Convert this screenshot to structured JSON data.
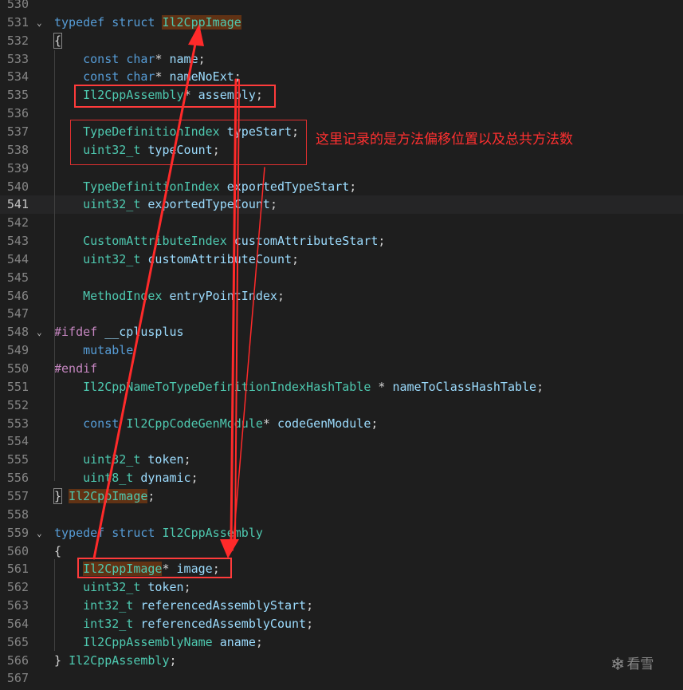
{
  "lines": [
    {
      "n": "530",
      "t": []
    },
    {
      "n": "531",
      "fold": "v",
      "t": [
        [
          "kw",
          "typedef"
        ],
        [
          "pl",
          " "
        ],
        [
          "kw",
          "struct"
        ],
        [
          "pl",
          " "
        ],
        [
          "ty hl",
          "Il2CppImage"
        ]
      ]
    },
    {
      "n": "532",
      "t": [
        [
          "pl br",
          "{"
        ]
      ]
    },
    {
      "n": "533",
      "t": [
        [
          "pl",
          "    "
        ],
        [
          "kw",
          "const"
        ],
        [
          "pl",
          " "
        ],
        [
          "kw",
          "char"
        ],
        [
          "pl",
          "* "
        ],
        [
          "id",
          "name"
        ],
        [
          "pl",
          ";"
        ]
      ]
    },
    {
      "n": "534",
      "t": [
        [
          "pl",
          "    "
        ],
        [
          "kw",
          "const"
        ],
        [
          "pl",
          " "
        ],
        [
          "kw",
          "char"
        ],
        [
          "pl",
          "* "
        ],
        [
          "id",
          "nameNoExt"
        ],
        [
          "pl",
          ";"
        ]
      ]
    },
    {
      "n": "535",
      "t": [
        [
          "pl",
          "    "
        ],
        [
          "ty",
          "Il2CppAssembly"
        ],
        [
          "pl",
          "* "
        ],
        [
          "id",
          "assembly"
        ],
        [
          "pl",
          ";"
        ]
      ]
    },
    {
      "n": "536",
      "t": []
    },
    {
      "n": "537",
      "t": [
        [
          "pl",
          "    "
        ],
        [
          "ty",
          "TypeDefinitionIndex"
        ],
        [
          "pl",
          " "
        ],
        [
          "id",
          "typeStart"
        ],
        [
          "pl",
          ";"
        ]
      ]
    },
    {
      "n": "538",
      "t": [
        [
          "pl",
          "    "
        ],
        [
          "ty",
          "uint32_t"
        ],
        [
          "pl",
          " "
        ],
        [
          "id",
          "typeCount"
        ],
        [
          "pl",
          ";"
        ]
      ]
    },
    {
      "n": "539",
      "t": []
    },
    {
      "n": "540",
      "t": [
        [
          "pl",
          "    "
        ],
        [
          "ty",
          "TypeDefinitionIndex"
        ],
        [
          "pl",
          " "
        ],
        [
          "id",
          "exportedTypeStart"
        ],
        [
          "pl",
          ";"
        ]
      ]
    },
    {
      "n": "541",
      "cur": true,
      "t": [
        [
          "pl",
          "    "
        ],
        [
          "ty",
          "uint32_t"
        ],
        [
          "pl",
          " "
        ],
        [
          "id",
          "exportedTypeCount"
        ],
        [
          "pl",
          ";"
        ]
      ]
    },
    {
      "n": "542",
      "t": []
    },
    {
      "n": "543",
      "t": [
        [
          "pl",
          "    "
        ],
        [
          "ty",
          "CustomAttributeIndex"
        ],
        [
          "pl",
          " "
        ],
        [
          "id",
          "customAttributeStart"
        ],
        [
          "pl",
          ";"
        ]
      ]
    },
    {
      "n": "544",
      "t": [
        [
          "pl",
          "    "
        ],
        [
          "ty",
          "uint32_t"
        ],
        [
          "pl",
          " "
        ],
        [
          "id",
          "customAttributeCount"
        ],
        [
          "pl",
          ";"
        ]
      ]
    },
    {
      "n": "545",
      "t": []
    },
    {
      "n": "546",
      "t": [
        [
          "pl",
          "    "
        ],
        [
          "ty",
          "MethodIndex"
        ],
        [
          "pl",
          " "
        ],
        [
          "id",
          "entryPointIndex"
        ],
        [
          "pl",
          ";"
        ]
      ]
    },
    {
      "n": "547",
      "t": []
    },
    {
      "n": "548",
      "fold": "v",
      "t": [
        [
          "pp",
          "#ifdef"
        ],
        [
          "pl",
          " "
        ],
        [
          "id",
          "__cplusplus"
        ]
      ]
    },
    {
      "n": "549",
      "t": [
        [
          "pl",
          "    "
        ],
        [
          "kw",
          "mutable"
        ]
      ]
    },
    {
      "n": "550",
      "t": [
        [
          "pp",
          "#endif"
        ]
      ]
    },
    {
      "n": "551",
      "t": [
        [
          "pl",
          "    "
        ],
        [
          "ty",
          "Il2CppNameToTypeDefinitionIndexHashTable"
        ],
        [
          "pl",
          " * "
        ],
        [
          "id",
          "nameToClassHashTable"
        ],
        [
          "pl",
          ";"
        ]
      ]
    },
    {
      "n": "552",
      "t": []
    },
    {
      "n": "553",
      "t": [
        [
          "pl",
          "    "
        ],
        [
          "kw",
          "const"
        ],
        [
          "pl",
          " "
        ],
        [
          "ty",
          "Il2CppCodeGenModule"
        ],
        [
          "pl",
          "* "
        ],
        [
          "id",
          "codeGenModule"
        ],
        [
          "pl",
          ";"
        ]
      ]
    },
    {
      "n": "554",
      "t": []
    },
    {
      "n": "555",
      "t": [
        [
          "pl",
          "    "
        ],
        [
          "ty",
          "uint32_t"
        ],
        [
          "pl",
          " "
        ],
        [
          "id",
          "token"
        ],
        [
          "pl",
          ";"
        ]
      ]
    },
    {
      "n": "556",
      "t": [
        [
          "pl",
          "    "
        ],
        [
          "ty",
          "uint8_t"
        ],
        [
          "pl",
          " "
        ],
        [
          "id",
          "dynamic"
        ],
        [
          "pl",
          ";"
        ]
      ]
    },
    {
      "n": "557",
      "t": [
        [
          "pl br",
          "}"
        ],
        [
          "pl",
          " "
        ],
        [
          "ty hl",
          "Il2CppImage"
        ],
        [
          "pl",
          ";"
        ]
      ]
    },
    {
      "n": "558",
      "t": []
    },
    {
      "n": "559",
      "fold": "v",
      "t": [
        [
          "kw",
          "typedef"
        ],
        [
          "pl",
          " "
        ],
        [
          "kw",
          "struct"
        ],
        [
          "pl",
          " "
        ],
        [
          "ty",
          "Il2CppAssembly"
        ]
      ]
    },
    {
      "n": "560",
      "t": [
        [
          "pl",
          "{"
        ]
      ]
    },
    {
      "n": "561",
      "t": [
        [
          "pl",
          "    "
        ],
        [
          "ty hl",
          "Il2CppImage"
        ],
        [
          "pl",
          "* "
        ],
        [
          "id",
          "image"
        ],
        [
          "pl",
          ";"
        ]
      ]
    },
    {
      "n": "562",
      "t": [
        [
          "pl",
          "    "
        ],
        [
          "ty",
          "uint32_t"
        ],
        [
          "pl",
          " "
        ],
        [
          "id",
          "token"
        ],
        [
          "pl",
          ";"
        ]
      ]
    },
    {
      "n": "563",
      "t": [
        [
          "pl",
          "    "
        ],
        [
          "ty",
          "int32_t"
        ],
        [
          "pl",
          " "
        ],
        [
          "id",
          "referencedAssemblyStart"
        ],
        [
          "pl",
          ";"
        ]
      ]
    },
    {
      "n": "564",
      "t": [
        [
          "pl",
          "    "
        ],
        [
          "ty",
          "int32_t"
        ],
        [
          "pl",
          " "
        ],
        [
          "id",
          "referencedAssemblyCount"
        ],
        [
          "pl",
          ";"
        ]
      ]
    },
    {
      "n": "565",
      "t": [
        [
          "pl",
          "    "
        ],
        [
          "ty",
          "Il2CppAssemblyName"
        ],
        [
          "pl",
          " "
        ],
        [
          "id",
          "aname"
        ],
        [
          "pl",
          ";"
        ]
      ]
    },
    {
      "n": "566",
      "t": [
        [
          "pl",
          "} "
        ],
        [
          "ty",
          "Il2CppAssembly"
        ],
        [
          "pl",
          ";"
        ]
      ]
    },
    {
      "n": "567",
      "t": []
    }
  ],
  "annotation": {
    "note": "这里记录的是方法偏移位置以及总共方法数",
    "color": "#ff3b3b"
  },
  "watermark": {
    "icon": "snowflake-icon",
    "text": "看雪"
  }
}
